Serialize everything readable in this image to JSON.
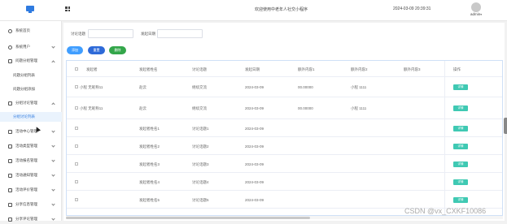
{
  "header": {
    "welcome": "欢迎使用中老年人社交小程序",
    "datetime": "2024-03-09 20:39:31",
    "username": "admin",
    "caret": "▾"
  },
  "sidebar": {
    "items": [
      {
        "label": "系统首页",
        "icon": "home-icon",
        "expanded": null
      },
      {
        "label": "系统用户",
        "icon": "user-icon",
        "expanded": false
      },
      {
        "label": "问题分组管理",
        "icon": "folder-icon",
        "expanded": true
      },
      {
        "label": "问题分组列表",
        "sub": true
      },
      {
        "label": "问题分组添加",
        "sub": true
      },
      {
        "label": "分组讨论管理",
        "icon": "folder-icon",
        "expanded": true
      },
      {
        "label": "分组讨论列表",
        "sub": true,
        "active": true
      },
      {
        "label": "活动中心管理",
        "icon": "folder-icon",
        "expanded": false
      },
      {
        "label": "活动类型管理",
        "icon": "folder-icon",
        "expanded": false
      },
      {
        "label": "活动报名管理",
        "icon": "folder-icon",
        "expanded": false
      },
      {
        "label": "活动通知管理",
        "icon": "folder-icon",
        "expanded": false
      },
      {
        "label": "活动评价管理",
        "icon": "folder-icon",
        "expanded": false
      },
      {
        "label": "分享信息管理",
        "icon": "folder-icon",
        "expanded": false
      },
      {
        "label": "分享评论管理",
        "icon": "folder-icon",
        "expanded": false
      }
    ]
  },
  "search": {
    "topic_label": "讨论话题",
    "topic_value": "",
    "time_label": "发起日期",
    "time_value": ""
  },
  "toolbar": {
    "add": "添加",
    "reset": "重置",
    "delete": "删除"
  },
  "table": {
    "headers": [
      "发起者",
      "发起者姓名",
      "讨论话题",
      "发起日期",
      "额外内容1",
      "额外内容2",
      "额外内容3",
      "操作"
    ],
    "rows": [
      [
        "小程 无昵称11",
        "赵云",
        "继续交流",
        "2024-03-09",
        "00.00000",
        "小程 1111",
        "",
        "详情"
      ],
      [
        "小程 无昵称11",
        "赵云",
        "继续交流",
        "2024-03-09",
        "00.00000",
        "小程 1111",
        "",
        "详情"
      ],
      [
        "",
        "发起者姓名1",
        "讨论话题1",
        "2024-03-09",
        "",
        "",
        "",
        "详情"
      ],
      [
        "",
        "发起者姓名2",
        "讨论话题2",
        "2024-03-09",
        "",
        "",
        "",
        "详情"
      ],
      [
        "",
        "发起者姓名3",
        "讨论话题3",
        "2024-03-09",
        "",
        "",
        "",
        "详情"
      ],
      [
        "",
        "发起者姓名4",
        "讨论话题4",
        "2024-03-09",
        "",
        "",
        "",
        "详情"
      ],
      [
        "",
        "发起者姓名5",
        "讨论话题5",
        "2024-03-09",
        "",
        "",
        "",
        "详情"
      ]
    ]
  },
  "watermark": "CSDN @vx_CXKF10086",
  "colors": {
    "primary": "#409eff",
    "reset": "#2e6ad8",
    "delete": "#33a64a",
    "detail": "#3fc9b3"
  }
}
